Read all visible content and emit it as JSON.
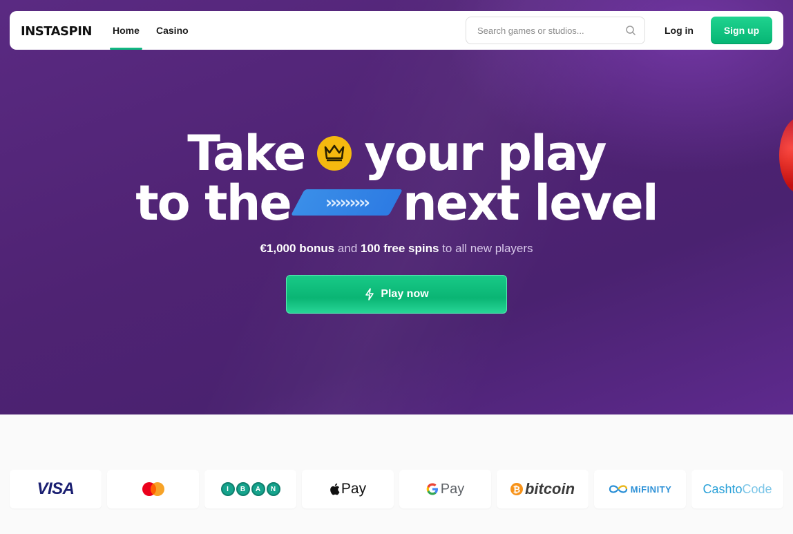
{
  "brand": {
    "logo_text": "INSTASPIN"
  },
  "nav": {
    "links": [
      {
        "label": "Home",
        "active": true
      },
      {
        "label": "Casino",
        "active": false
      }
    ],
    "search_placeholder": "Search games or studios...",
    "login_label": "Log in",
    "signup_label": "Sign up",
    "accent_color": "#10b981"
  },
  "hero": {
    "headline_line1_a": "Take",
    "headline_line1_b": "your play",
    "headline_line2_a": "to the",
    "headline_line2_b": "next level",
    "arrows_glyph": "›››››››››",
    "sub_bonus": "€1,000 bonus",
    "sub_and": "and",
    "sub_spins": "100 free spins",
    "sub_rest": "to all new players",
    "cta_label": "Play now",
    "background_color": "#4f2373"
  },
  "payments": {
    "visa": "VISA",
    "iban_letters": [
      "I",
      "B",
      "A",
      "N"
    ],
    "apple_pay": "Pay",
    "google_pay": "Pay",
    "bitcoin": "bitcoin",
    "bitcoin_symbol": "₿",
    "mifinity": "MiFINITY",
    "cashto": "Cashto",
    "code": "Code"
  }
}
